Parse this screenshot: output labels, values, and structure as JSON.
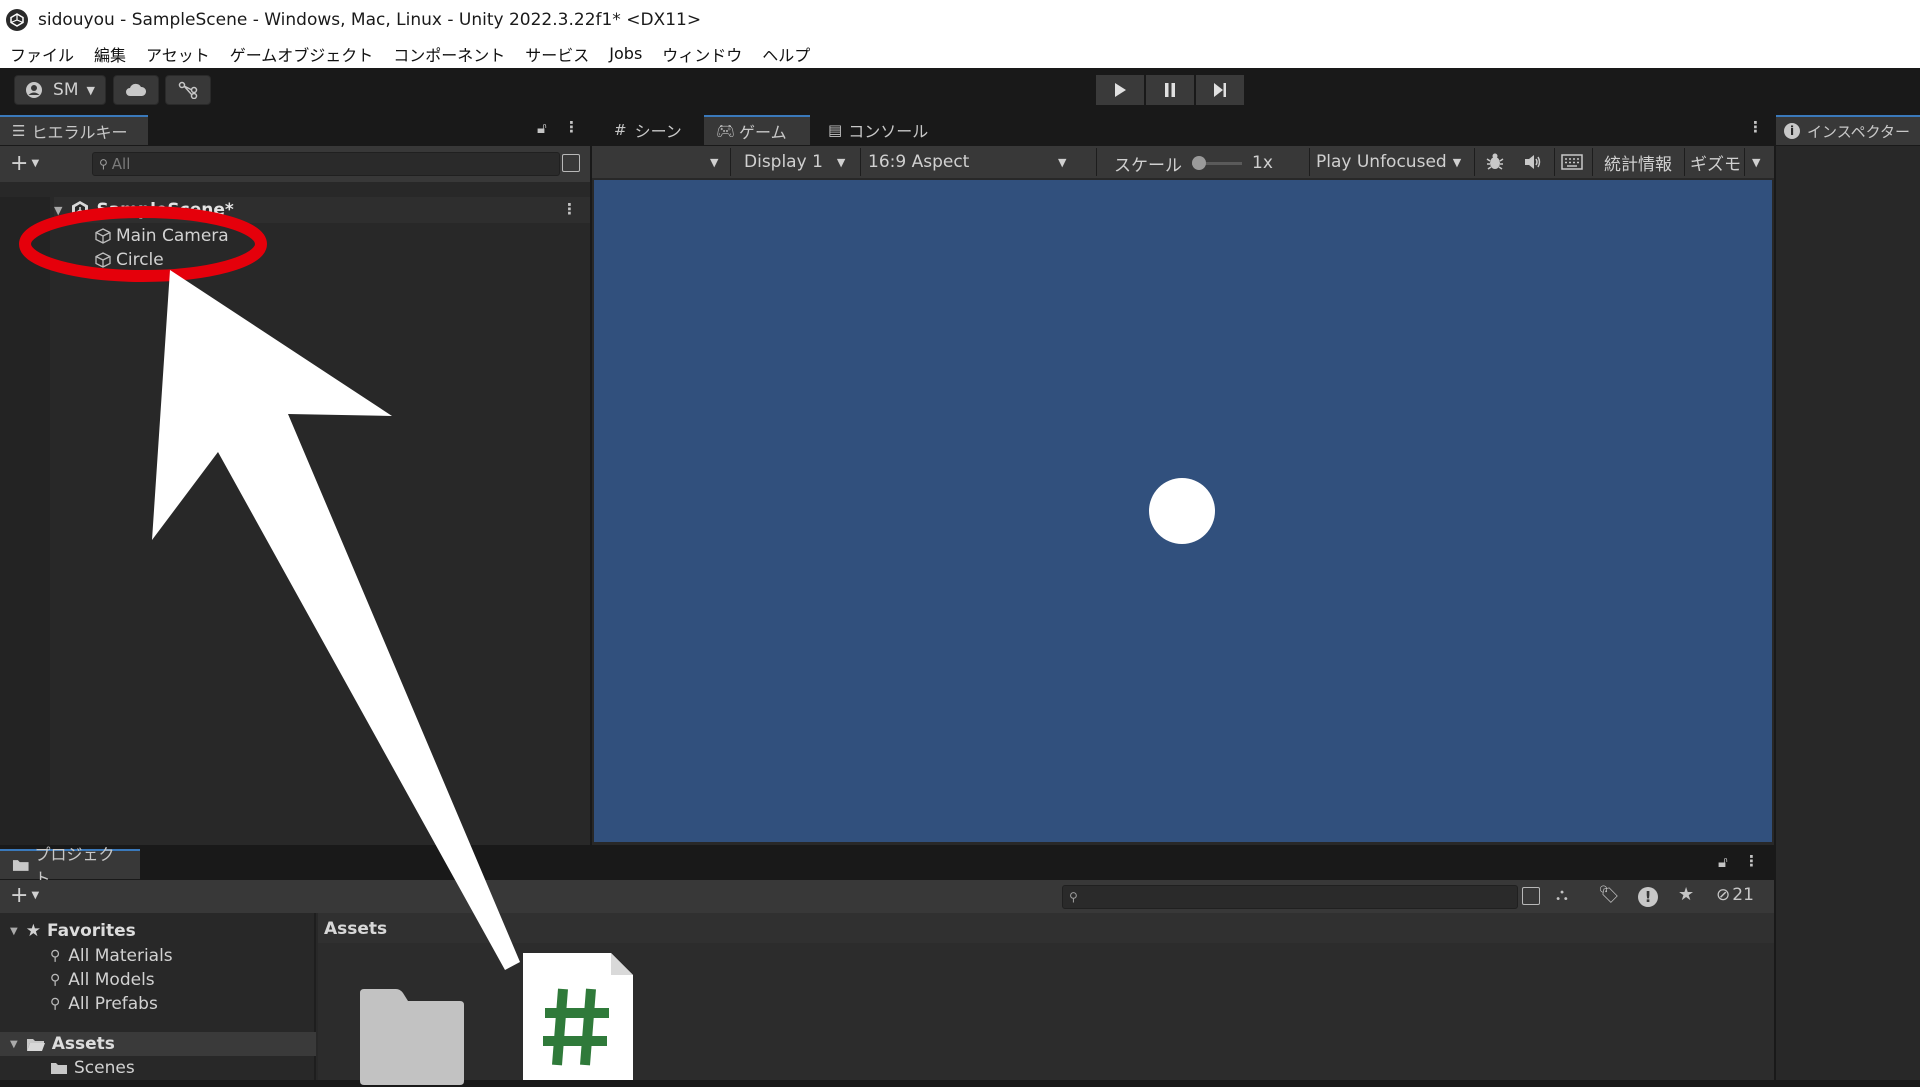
{
  "window": {
    "title": "sidouyou - SampleScene - Windows, Mac, Linux - Unity 2022.3.22f1* <DX11>"
  },
  "menu": [
    "ファイル",
    "編集",
    "アセット",
    "ゲームオブジェクト",
    "コンポーネント",
    "サービス",
    "Jobs",
    "ウィンドウ",
    "ヘルプ"
  ],
  "toolbar": {
    "account_label": "SM"
  },
  "hierarchy": {
    "tab_label": "ヒエラルキー",
    "search_placeholder": "All",
    "scene_name": "SampleScene*",
    "items": [
      "Main Camera",
      "Circle"
    ]
  },
  "center_tabs": [
    "シーン",
    "ゲーム",
    "コンソール"
  ],
  "game_toolbar": {
    "display": "Display 1",
    "aspect": "16:9 Aspect",
    "scale_label": "スケール",
    "scale_value": "1x",
    "play_mode": "Play Unfocused",
    "stats": "統計情報",
    "gizmos": "ギズモ"
  },
  "inspector": {
    "tab_label": "インスペクター"
  },
  "project": {
    "tab_label": "プロジェクト",
    "breadcrumb": "Assets",
    "hidden_count": "21",
    "favorites_label": "Favorites",
    "favorites": [
      "All Materials",
      "All Models",
      "All Prefabs"
    ],
    "assets_label": "Assets",
    "assets_children": [
      "Scenes"
    ]
  },
  "colors": {
    "game_background": "#31507d",
    "annotation_red": "#e5000b",
    "script_green": "#2f7a3a"
  }
}
